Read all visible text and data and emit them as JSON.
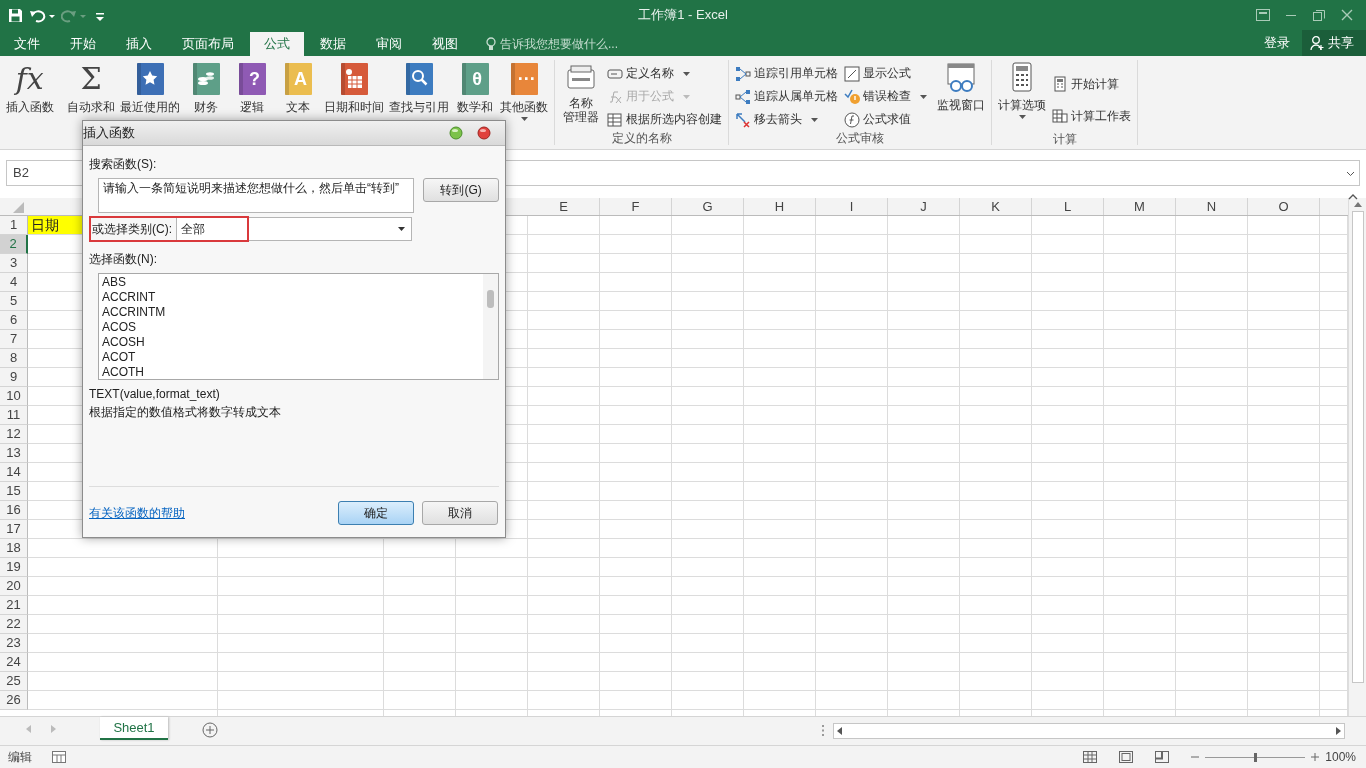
{
  "window": {
    "title": "工作簿1 - Excel"
  },
  "tabs": [
    {
      "label": "文件",
      "selected": false
    },
    {
      "label": "开始",
      "selected": false
    },
    {
      "label": "插入",
      "selected": false
    },
    {
      "label": "页面布局",
      "selected": false
    },
    {
      "label": "公式",
      "selected": true
    },
    {
      "label": "数据",
      "selected": false
    },
    {
      "label": "审阅",
      "selected": false
    },
    {
      "label": "视图",
      "selected": false
    }
  ],
  "tell_me": {
    "placeholder": "告诉我您想要做什么..."
  },
  "account": {
    "sign_in": "登录",
    "share": "共享"
  },
  "ribbon": {
    "function_library": [
      {
        "label": "插入函数",
        "glyph": "fx",
        "dropdown": false
      },
      {
        "label": "自动求和",
        "glyph": "Σ",
        "dropdown": false
      },
      {
        "label": "最近使用的",
        "color": "#3d6fb5",
        "dropdown": false
      },
      {
        "label": "财务",
        "color": "#5e9f88",
        "dropdown": false
      },
      {
        "label": "逻辑",
        "color": "#8f5ab4",
        "glyph": "?",
        "dropdown": false
      },
      {
        "label": "文本",
        "color": "#ebbd4f",
        "glyph": "A",
        "dropdown": false
      },
      {
        "label": "日期和时间",
        "color": "#d65a3a",
        "dropdown": false
      },
      {
        "label": "查找与引用",
        "color": "#3d7cc0",
        "dropdown": false
      },
      {
        "label": "数学和",
        "color": "#5e9f88",
        "glyph": "θ",
        "dropdown": false
      },
      {
        "label": "其他函数",
        "color": "#e8863a",
        "glyph": "···",
        "dropdown": true
      }
    ],
    "defined_names": {
      "title": "定义的名称",
      "large": {
        "lines": [
          "名称",
          "管理器"
        ]
      },
      "items": [
        {
          "label": "定义名称",
          "disabled": false,
          "dropdown": true
        },
        {
          "label": "用于公式",
          "disabled": true,
          "dropdown": true
        },
        {
          "label": "根据所选内容创建",
          "disabled": false,
          "dropdown": false
        }
      ]
    },
    "formula_auditing": {
      "title": "公式审核",
      "items": [
        {
          "label": "追踪引用单元格",
          "dropdown": false
        },
        {
          "label": "追踪从属单元格",
          "dropdown": false
        },
        {
          "label": "移去箭头",
          "dropdown": true
        },
        {
          "label": "显示公式",
          "dropdown": false
        },
        {
          "label": "错误检查",
          "dropdown": true
        },
        {
          "label": "公式求值",
          "dropdown": false
        }
      ],
      "large": {
        "label": "监视窗口"
      }
    },
    "calculation": {
      "title": "计算",
      "large": {
        "label": "计算选项",
        "dropdown": true
      },
      "items": [
        {
          "label": "开始计算"
        },
        {
          "label": "计算工作表"
        }
      ]
    }
  },
  "formula_bar": {
    "name_box": "B2"
  },
  "sheet": {
    "columns": [
      "E",
      "F",
      "G",
      "H",
      "I",
      "J",
      "K",
      "L",
      "M",
      "N",
      "O"
    ],
    "rows": [
      {
        "label": "1",
        "selected": false
      },
      {
        "label": "2",
        "selected": true
      },
      {
        "label": "3",
        "selected": false
      },
      {
        "label": "4",
        "selected": false
      },
      {
        "label": "5",
        "selected": false
      },
      {
        "label": "6",
        "selected": false
      },
      {
        "label": "7",
        "selected": false
      },
      {
        "label": "8",
        "selected": false
      },
      {
        "label": "9",
        "selected": false
      },
      {
        "label": "10",
        "selected": false
      },
      {
        "label": "11",
        "selected": false
      },
      {
        "label": "12",
        "selected": false
      },
      {
        "label": "13",
        "selected": false
      },
      {
        "label": "14",
        "selected": false
      },
      {
        "label": "15",
        "selected": false
      },
      {
        "label": "16",
        "selected": false
      },
      {
        "label": "17",
        "selected": false
      },
      {
        "label": "18",
        "selected": false
      },
      {
        "label": "19",
        "selected": false
      },
      {
        "label": "20",
        "selected": false
      },
      {
        "label": "21",
        "selected": false
      },
      {
        "label": "22",
        "selected": false
      },
      {
        "label": "23",
        "selected": false
      },
      {
        "label": "24",
        "selected": false
      },
      {
        "label": "25",
        "selected": false
      },
      {
        "label": "26",
        "selected": false
      }
    ],
    "cell_a1": {
      "text": "日期",
      "highlighted": true
    }
  },
  "dialog": {
    "title": "插入函数",
    "search_label": "搜索函数(S):",
    "search_value": "请输入一条简短说明来描述您想做什么，然后单击“转到”",
    "go_button": "转到(G)",
    "category_label": "或选择类别(C):",
    "category_value": "全部",
    "category_highlighted": true,
    "functions_label": "选择函数(N):",
    "functions": [
      {
        "name": "ABS",
        "selected": false
      },
      {
        "name": "ACCRINT",
        "selected": false
      },
      {
        "name": "ACCRINTM",
        "selected": false
      },
      {
        "name": "ACOS",
        "selected": false
      },
      {
        "name": "ACOSH",
        "selected": false
      },
      {
        "name": "ACOT",
        "selected": false
      },
      {
        "name": "ACOTH",
        "selected": false
      }
    ],
    "signature": "TEXT(value,format_text)",
    "description": "根据指定的数值格式将数字转成文本",
    "help_link": "有关该函数的帮助",
    "ok": "确定",
    "cancel": "取消"
  },
  "sheet_tabs": [
    {
      "label": "Sheet1",
      "selected": true
    }
  ],
  "status_bar": {
    "mode": "编辑",
    "zoom": "100%",
    "zoom_slider": {
      "level": 0.5
    }
  }
}
